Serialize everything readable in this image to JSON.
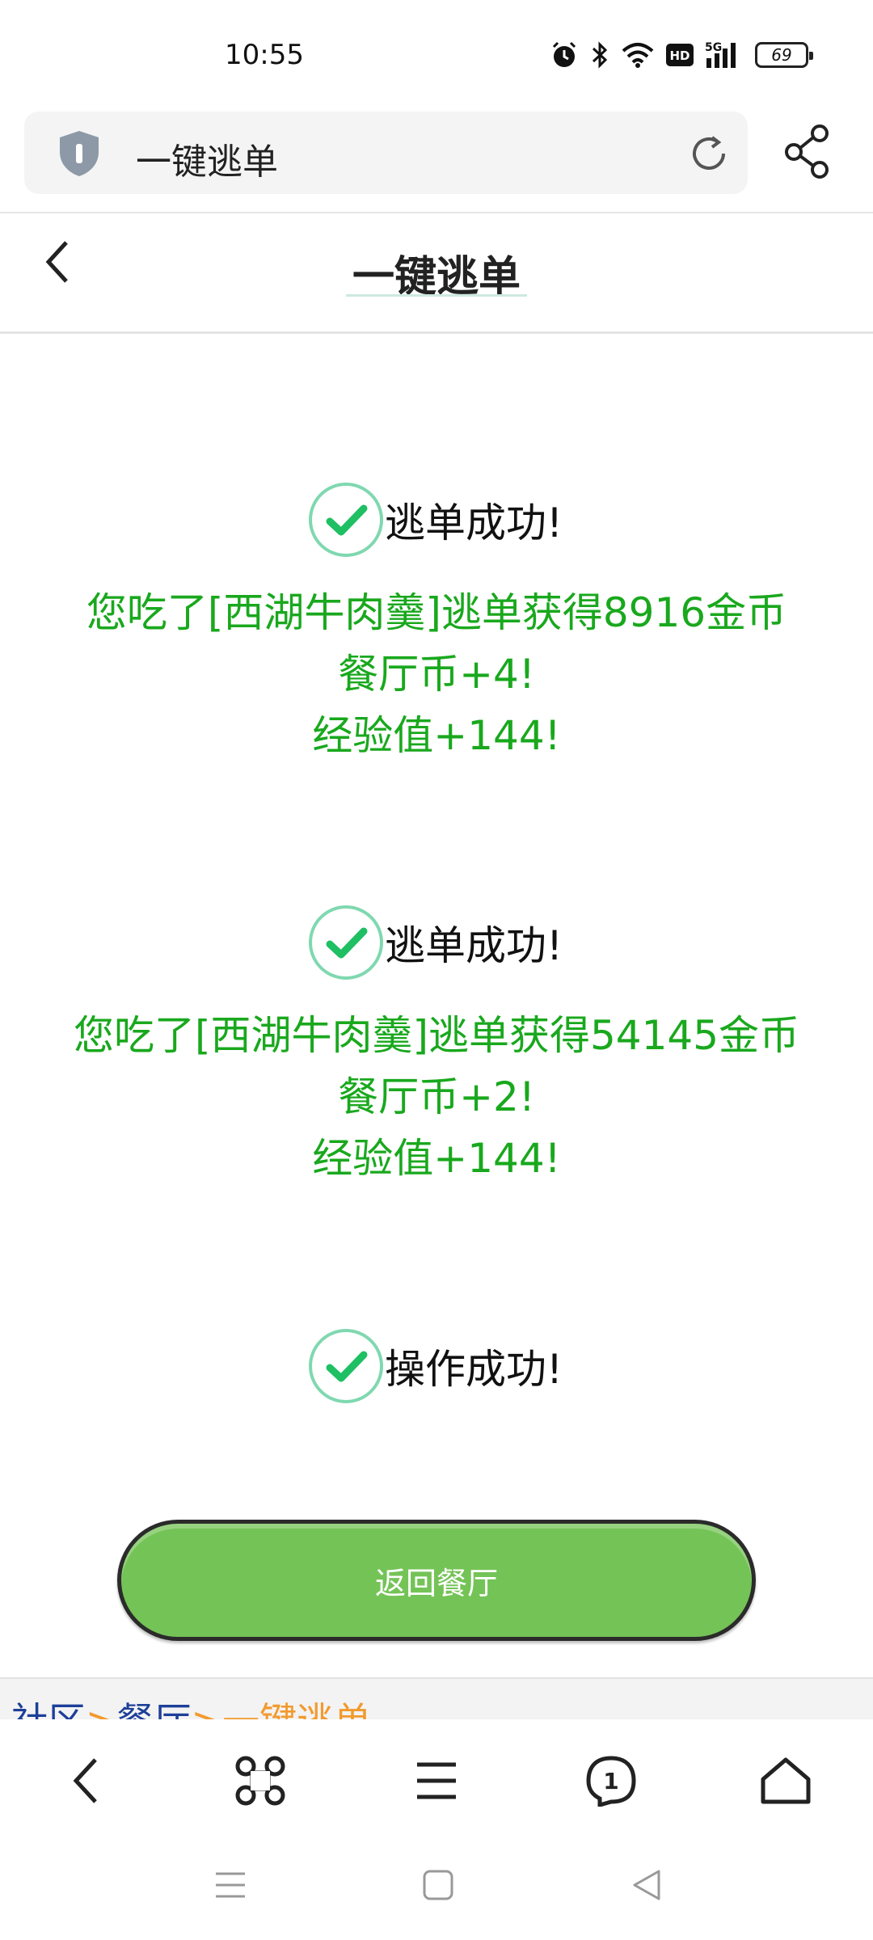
{
  "status_bar": {
    "time": "10:55",
    "network_label": "5G",
    "hd_label": "HD",
    "battery_level": "69",
    "icons": [
      "alarm-icon",
      "bluetooth-icon",
      "wifi-icon",
      "hd-icon",
      "signal-5g-icon",
      "battery-icon"
    ]
  },
  "address_bar": {
    "text": "一键逃单",
    "icons": [
      "shield-icon",
      "refresh-icon",
      "share-icon"
    ]
  },
  "header": {
    "title": "一键逃单"
  },
  "results": [
    {
      "title": "逃单成功!",
      "lines": [
        "您吃了[西湖牛肉羹]逃单获得8916金币",
        "餐厅币+4!",
        "经验值+144!"
      ]
    },
    {
      "title": "逃单成功!",
      "lines": [
        "您吃了[西湖牛肉羹]逃单获得54145金币",
        "餐厅币+2!",
        "经验值+144!"
      ]
    },
    {
      "title": "操作成功!",
      "lines": []
    }
  ],
  "return_button": {
    "label": "返回餐厅"
  },
  "breadcrumb": {
    "items": [
      "社区",
      "餐厅",
      "一键逃单"
    ],
    "separator": ">"
  },
  "toolbar": {
    "tab_count": "1",
    "icons": [
      "back-icon",
      "command-icon",
      "menu-icon",
      "tabs-icon",
      "home-icon"
    ]
  },
  "colors": {
    "success_green": "#19a81d",
    "button_green": "#74c356",
    "breadcrumb_link": "#1d3f99",
    "breadcrumb_current": "#f29a2e"
  }
}
